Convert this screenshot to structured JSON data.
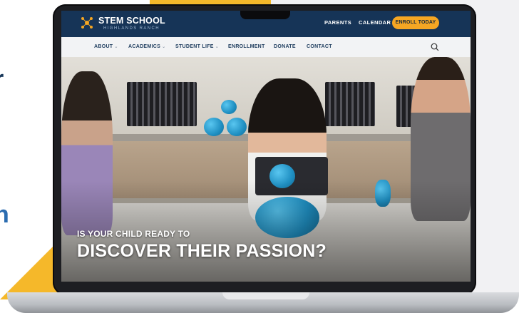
{
  "page_side_letters": [
    "r",
    "n"
  ],
  "site": {
    "logo": {
      "title": "STEM SCHOOL",
      "subtitle": "HIGHLANDS RANCH"
    },
    "top_links": [
      "PARENTS",
      "CALENDAR"
    ],
    "cta_button": "ENROLL TODAY",
    "nav": [
      {
        "label": "ABOUT",
        "dropdown": true
      },
      {
        "label": "ACADEMICS",
        "dropdown": true
      },
      {
        "label": "STUDENT LIFE",
        "dropdown": true
      },
      {
        "label": "ENROLLMENT",
        "dropdown": false
      },
      {
        "label": "DONATE",
        "dropdown": false
      },
      {
        "label": "CONTACT",
        "dropdown": false
      }
    ],
    "hero": {
      "subheading": "IS YOUR CHILD READY TO",
      "heading": "DISCOVER THEIR PASSION?"
    }
  },
  "colors": {
    "header_navy": "#163457",
    "cta_orange": "#f5a623",
    "nav_bg": "#f2f3f5",
    "accent_yellow": "#f5b82a"
  },
  "icons": [
    "logo-mark-icon",
    "chevron-down-icon",
    "search-icon"
  ]
}
